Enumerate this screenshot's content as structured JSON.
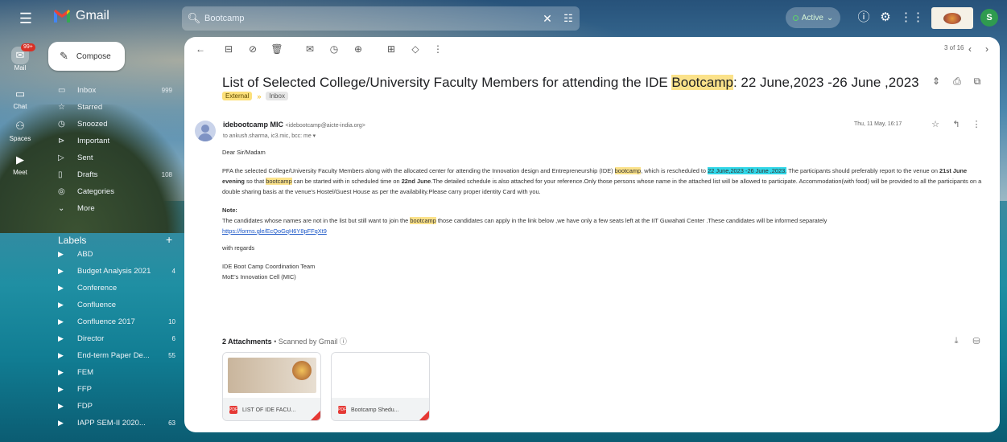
{
  "app": {
    "name": "Gmail",
    "search_value": "Bootcamp",
    "status": "Active",
    "avatar_letter": "S"
  },
  "rail": [
    {
      "label": "Mail",
      "badge": "99+"
    },
    {
      "label": "Chat"
    },
    {
      "label": "Spaces"
    },
    {
      "label": "Meet"
    }
  ],
  "compose_label": "Compose",
  "nav": [
    {
      "icon": "inbox-icon",
      "glyph": "▭",
      "label": "Inbox",
      "count": "999"
    },
    {
      "icon": "star-icon",
      "glyph": "☆",
      "label": "Starred",
      "count": ""
    },
    {
      "icon": "clock-icon",
      "glyph": "◷",
      "label": "Snoozed",
      "count": ""
    },
    {
      "icon": "important-icon",
      "glyph": "⊳",
      "label": "Important",
      "count": ""
    },
    {
      "icon": "send-icon",
      "glyph": "▷",
      "label": "Sent",
      "count": ""
    },
    {
      "icon": "draft-icon",
      "glyph": "▯",
      "label": "Drafts",
      "count": "108"
    },
    {
      "icon": "category-icon",
      "glyph": "◎",
      "label": "Categories",
      "count": ""
    },
    {
      "icon": "chevron-down-icon",
      "glyph": "⌄",
      "label": "More",
      "count": ""
    }
  ],
  "labels_heading": "Labels",
  "labels": [
    {
      "label": "ABD",
      "count": ""
    },
    {
      "label": "Budget Analysis 2021",
      "count": "4"
    },
    {
      "label": "Conference",
      "count": ""
    },
    {
      "label": "Confluence",
      "count": ""
    },
    {
      "label": "Confluence 2017",
      "count": "10"
    },
    {
      "label": "Director",
      "count": "6"
    },
    {
      "label": "End-term Paper De...",
      "count": "55"
    },
    {
      "label": "FEM",
      "count": ""
    },
    {
      "label": "FFP",
      "count": ""
    },
    {
      "label": "FDP",
      "count": ""
    },
    {
      "label": "IAPP SEM-II 2020...",
      "count": "63"
    }
  ],
  "toolbar": {
    "pager": "3 of 16"
  },
  "email": {
    "subject_before": "List of Selected College/University Faculty Members for attending the IDE ",
    "subject_highlight": "Bootcamp",
    "subject_after": ": 22 June,2023 -26 June ,2023",
    "chip_external": "External",
    "chip_inbox": "Inbox",
    "sender_name": "idebootcamp MIC",
    "sender_address": "<idebootcamp@aicte-india.org>",
    "recipients": "to ankush.sharma, ic3.mic, bcc: me",
    "date": "Thu, 11 May, 16:17",
    "greeting": "Dear Sir/Madam",
    "para1_a": "PFA the selected College/University Faculty Members along with the allocated center for attending the Innovation design and Entrepreneurship (IDE) ",
    "para1_hl1": "bootcamp",
    "para1_b": ", which is rescheduled to ",
    "para1_hl2": "22 June,2023 -26 June ,2023.",
    "para1_c": " The participants should preferably  report to the venue on ",
    "para1_bold1": "21st June evening",
    "para1_d": " so that ",
    "para1_hl3": "bootcamp",
    "para1_e": " can be started  with in scheduled time on ",
    "para1_bold2": "22nd June",
    "para1_f": ".The detailed schedule is also attached for your reference.Only those persons  whose name in the attached list will be allowed to participate. Accommodation(with food) will be provided  to all the participants on a double  sharing basis at the venue's Hostel/Guest House as per the availability.Please carry proper identity Card with you.",
    "note_label": "Note:",
    "note_a": "The candidates whose names are not in the list but still want to join the ",
    "note_hl": "bootcamp",
    "note_b": " those  candidates can apply in the link below ,we have only a few seats left at the IIT Guwahati Center .These candidates will be informed separately",
    "note_link": "https://forms.gle/EcQoGqH6Y8pFFqXt9",
    "closing": "with regards",
    "sig1": "IDE Boot Camp Coordination Team",
    "sig2": "MoE's Innovation Cell (MIC)"
  },
  "attachments": {
    "count_label": "2 Attachments",
    "scanned": " • Scanned by Gmail ⓘ",
    "files": [
      {
        "name": "LIST OF IDE FACU..."
      },
      {
        "name": "Bootcamp Shedu..."
      }
    ]
  }
}
